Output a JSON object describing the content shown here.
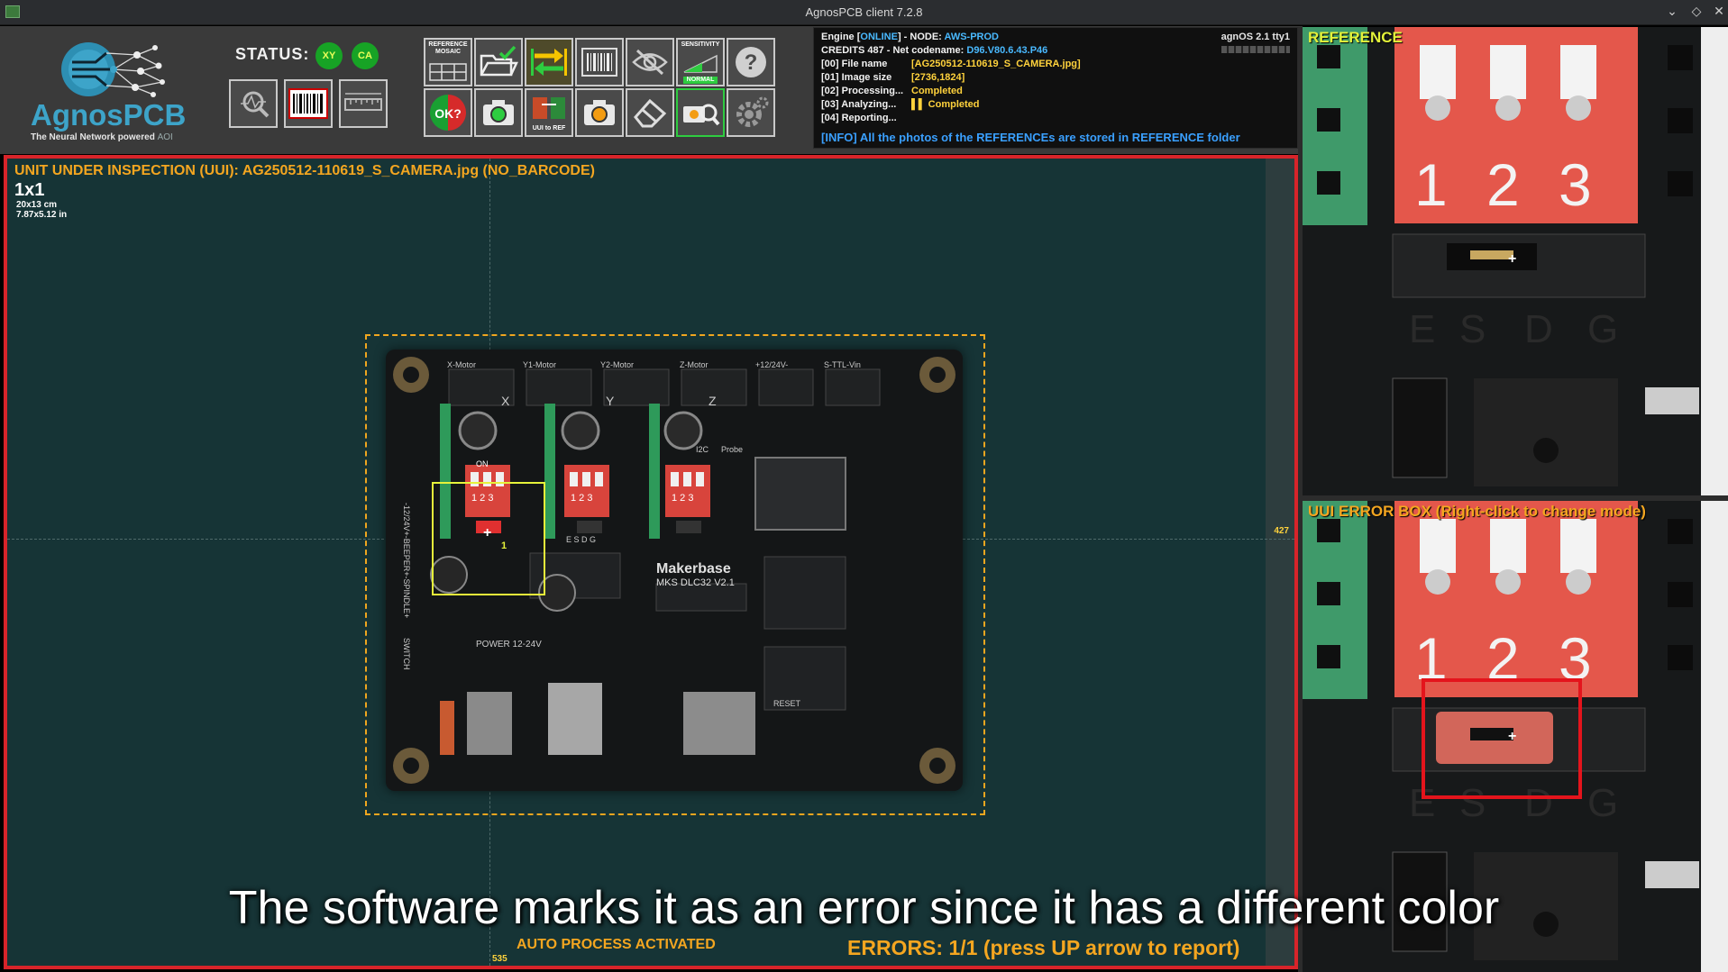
{
  "window": {
    "title": "AgnosPCB client 7.2.8"
  },
  "logo": {
    "brand": "AgnosPCB",
    "tagline": "The Neural Network powered",
    "tagline_suffix": "AOI"
  },
  "status": {
    "label": "STATUS:",
    "badges": [
      "XY",
      "CA"
    ]
  },
  "toolbar": {
    "reference_mosaic_label": "REFERENCE MOSAIC",
    "sensitivity_label": "SENSITIVITY",
    "sensitivity_value": "NORMAL",
    "ok_label": "OK?",
    "uui_to_ref_label": "UUI to REF"
  },
  "console": {
    "engine_prefix": "Engine [",
    "engine_status": "ONLINE",
    "engine_mid": "] - NODE: ",
    "node": "AWS-PROD",
    "os": "agnOS 2.1 tty1",
    "credits_prefix": "CREDITS 487 - Net codename: ",
    "codename": "D96.V80.6.43.P46",
    "file_label": "[00] File name",
    "file_value": "[AG250512-110619_S_CAMERA.jpg]",
    "size_label": "[01] Image size",
    "size_value": "[2736,1824]",
    "proc_label": "[02] Processing...",
    "proc_value": "Completed",
    "anal_label": "[03] Analyzing...",
    "anal_value": "Completed",
    "report_label": "[04] Reporting...",
    "info": "[INFO] All the photos of the REFERENCEs are stored in REFERENCE folder"
  },
  "inspection": {
    "title": "UNIT UNDER INSPECTION (UUI): AG250512-110619_S_CAMERA.jpg (NO_BARCODE)",
    "grid": "1x1",
    "size_cm": "20x13 cm",
    "size_in": "7.87x5.12 in",
    "coord_y": "427",
    "coord_x": "535",
    "error_marker": "1",
    "auto_process": "AUTO PROCESS ACTIVATED",
    "errors": "ERRORS: 1/1 (press UP arrow to report)"
  },
  "board": {
    "headers": [
      "X-Motor",
      "Y1-Motor",
      "Y2-Motor",
      "Z-Motor",
      "+12/24V-",
      "S-TTL-Vin"
    ],
    "axis_labels": [
      "X",
      "Y",
      "Z"
    ],
    "brand": "Makerbase",
    "model": "MKS DLC32 V2.1",
    "power": "POWER 12-24V",
    "side_label": "-12/24V+-BEEPER+-SPINDLE+",
    "switch": "SWITCH",
    "reset": "RESET",
    "probe": "Probe",
    "i2c": "I2C",
    "dip_on": "ON",
    "dip_nums": "1 2 3",
    "esdg": "E S D G"
  },
  "reference": {
    "title": "REFERENCE",
    "digits": [
      "1",
      "2",
      "3"
    ],
    "pins": [
      "E",
      "S",
      "D",
      "G"
    ]
  },
  "error_box": {
    "title": "UUI ERROR BOX (Right-click to change mode)",
    "digits": [
      "1",
      "2",
      "3"
    ],
    "pins": [
      "E",
      "S",
      "D",
      "G"
    ]
  },
  "subtitle": "The software marks it as an error since it has a different color",
  "colors": {
    "accent_orange": "#f4a620",
    "error_red": "#d8242a",
    "status_green": "#17a325",
    "brand_blue": "#3da4c9"
  }
}
